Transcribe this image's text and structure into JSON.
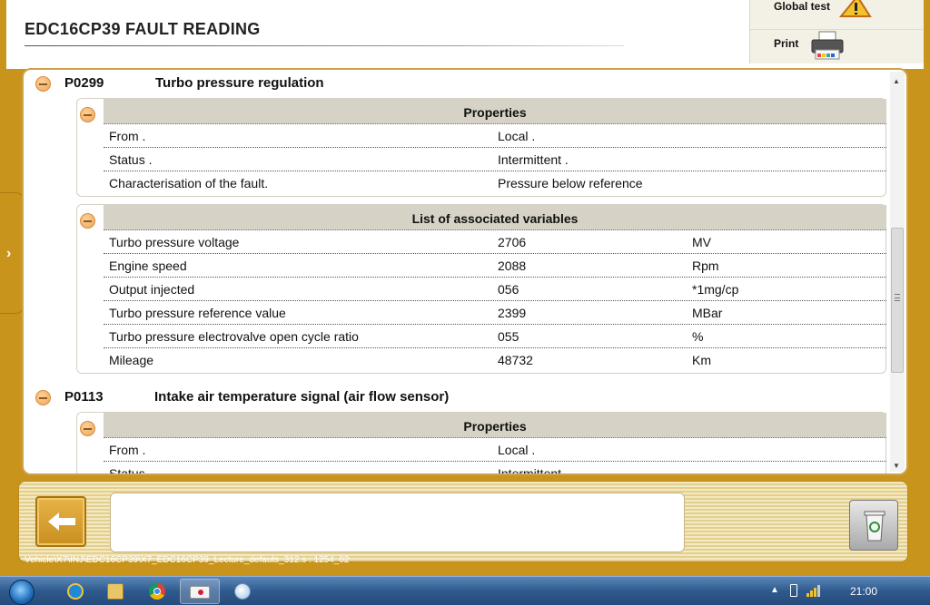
{
  "header": {
    "title": "EDC16CP39  FAULT READING",
    "global_test_label": "Global test",
    "print_label": "Print"
  },
  "faults": [
    {
      "code": "P0299",
      "description": "Turbo pressure regulation",
      "properties": {
        "heading": "Properties",
        "rows": [
          [
            "From .",
            "Local ."
          ],
          [
            "Status .",
            "Intermittent ."
          ],
          [
            "Characterisation of the fault.",
            "Pressure below reference"
          ]
        ]
      },
      "variables": {
        "heading": "List of associated variables",
        "rows": [
          [
            "Turbo pressure voltage",
            "2706",
            "MV"
          ],
          [
            "Engine speed",
            "2088",
            "Rpm"
          ],
          [
            "Output injected",
            "056",
            "*1mg/cp"
          ],
          [
            "Turbo pressure reference value",
            "2399",
            "MBar"
          ],
          [
            "Turbo pressure electrovalve open cycle ratio",
            "055",
            "%"
          ],
          [
            "Mileage",
            "48732",
            "Km"
          ]
        ]
      }
    },
    {
      "code": "P0113",
      "description": "Intake air temperature signal (air flow sensor)",
      "properties": {
        "heading": "Properties",
        "rows": [
          [
            "From .",
            "Local ."
          ],
          [
            "Status .",
            "Intermittent ."
          ]
        ]
      }
    }
  ],
  "footer": {
    "message": "",
    "file_path": "Vehicle\\X7\\INJ\\EDC16CP39\\X7_EDC16CP39_Lecture_defauts_312.s : 1254_02"
  },
  "taskbar": {
    "clock": "21:00"
  },
  "colors": {
    "frame": "#c9941c",
    "section_header": "#d6d2c5",
    "taskbar": "#2f5a8e"
  }
}
